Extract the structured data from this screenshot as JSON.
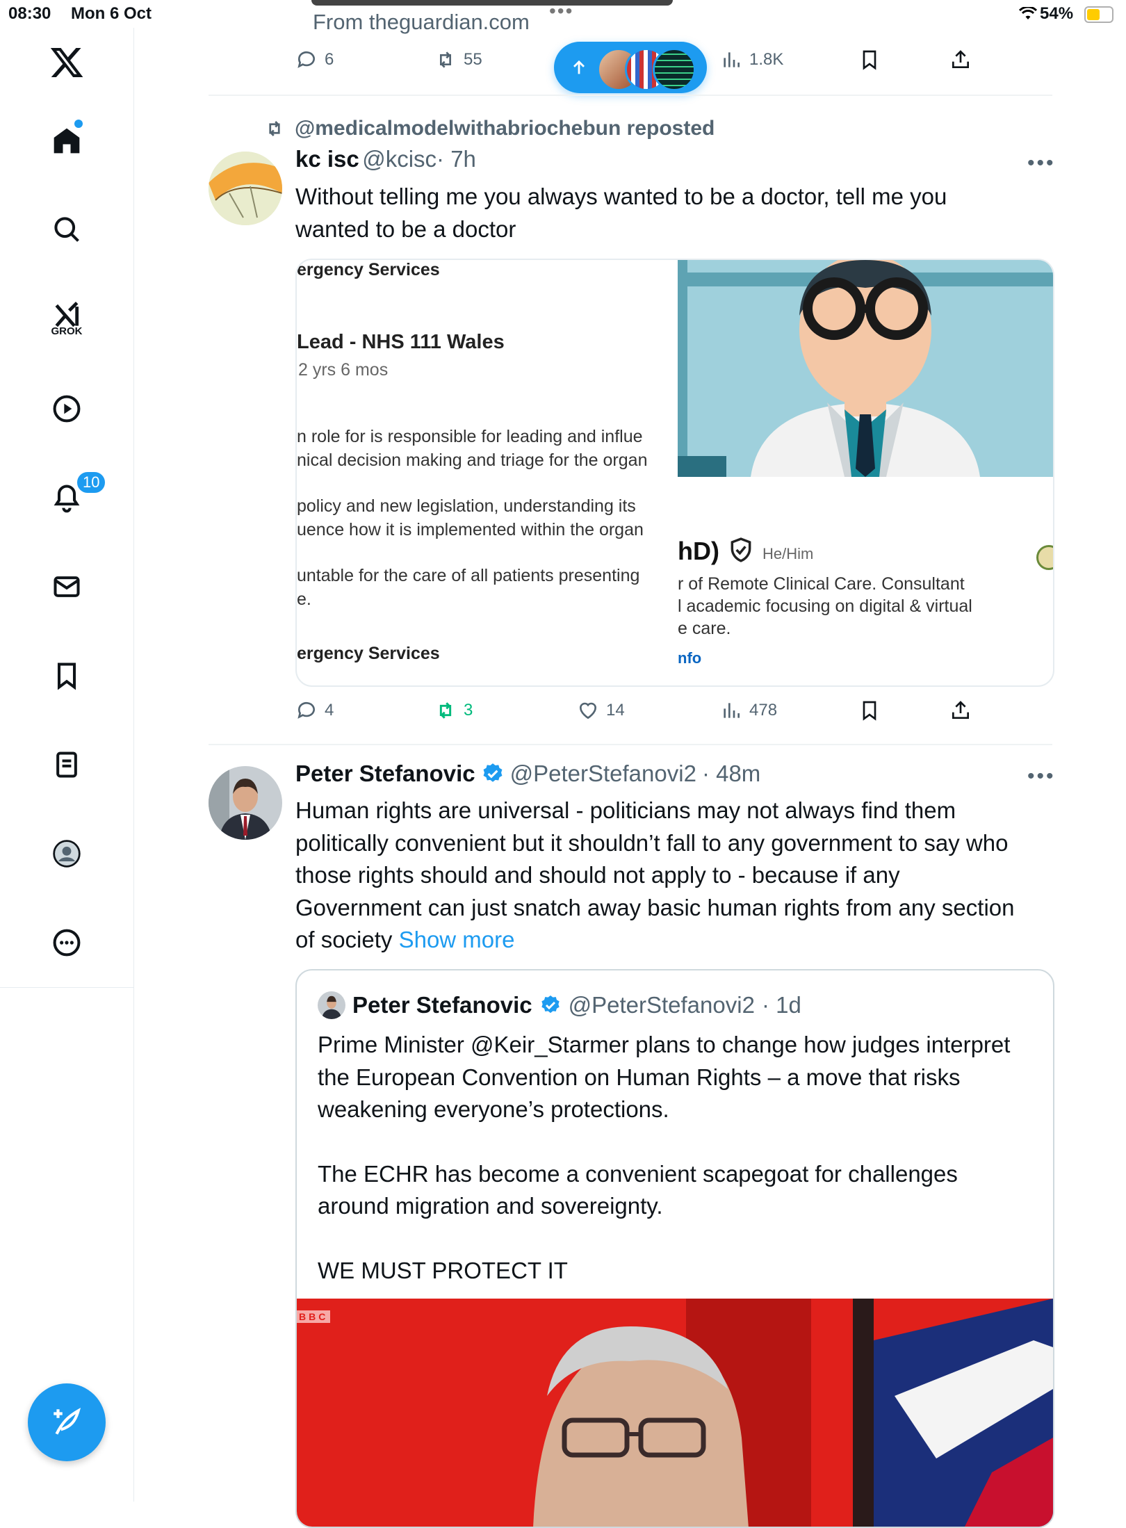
{
  "status_bar": {
    "time": "08:30",
    "date": "Mon 6 Oct",
    "battery": "54%"
  },
  "sidebar": {
    "grok_label": "GROK",
    "notifications_badge": "10"
  },
  "top_tweet": {
    "source": "From theguardian.com",
    "replies": "6",
    "reposts": "55",
    "views": "1.8K"
  },
  "tweet1": {
    "repost_label": "@medicalmodelwithabriochebun reposted",
    "name": "kc isc",
    "handle": "@kcisc",
    "time": "· 7h",
    "text_line1": "Without telling me you always wanted to be a doctor, tell me you",
    "text_line2": "wanted to be a doctor",
    "card": {
      "l1": "ergency Services",
      "l2": "Lead - NHS 111 Wales",
      "l3": "2 yrs 6 mos",
      "l4": "n role for is responsible for leading and influe",
      "l5": "nical decision making and triage for the organ",
      "l6": "policy and new legislation, understanding its",
      "l7": "uence how it is implemented within the organ",
      "l8": "untable for the care of all patients presenting",
      "l9": "e.",
      "l10": "ergency Services",
      "r1": "hD)",
      "r1b": "He/Him",
      "r2": "r of Remote Clinical Care. Consultant",
      "r3": "l academic focusing on digital & virtual",
      "r4": "e care.",
      "r5": "nfo"
    },
    "replies": "4",
    "reposts": "3",
    "likes": "14",
    "views": "478"
  },
  "tweet2": {
    "name": "Peter Stefanovic",
    "handle": "@PeterStefanovi2",
    "time": "· 48m",
    "lines": [
      "Human rights are universal - politicians may not always find them",
      "politically convenient but it shouldn’t fall to any government to say who",
      "those rights should and should not apply to - because if any",
      "Government can just snatch away basic human rights from any section"
    ],
    "last_line": "of society",
    "show_more": "Show more",
    "quote": {
      "name": "Peter Stefanovic",
      "handle": "@PeterStefanovi2",
      "time": "· 1d",
      "p1": [
        "Prime Minister @Keir_Starmer plans to change how judges interpret",
        "the European Convention on Human Rights – a move that risks",
        "weakening everyone’s protections."
      ],
      "p2": [
        "The ECHR has become a convenient scapegoat for challenges",
        "around migration and sovereignty."
      ],
      "p3": "WE MUST PROTECT IT",
      "bbc": "BBC"
    }
  },
  "colors": {
    "accent": "#1d9bf0",
    "repost_green": "#00ba7c",
    "muted": "#536471"
  }
}
